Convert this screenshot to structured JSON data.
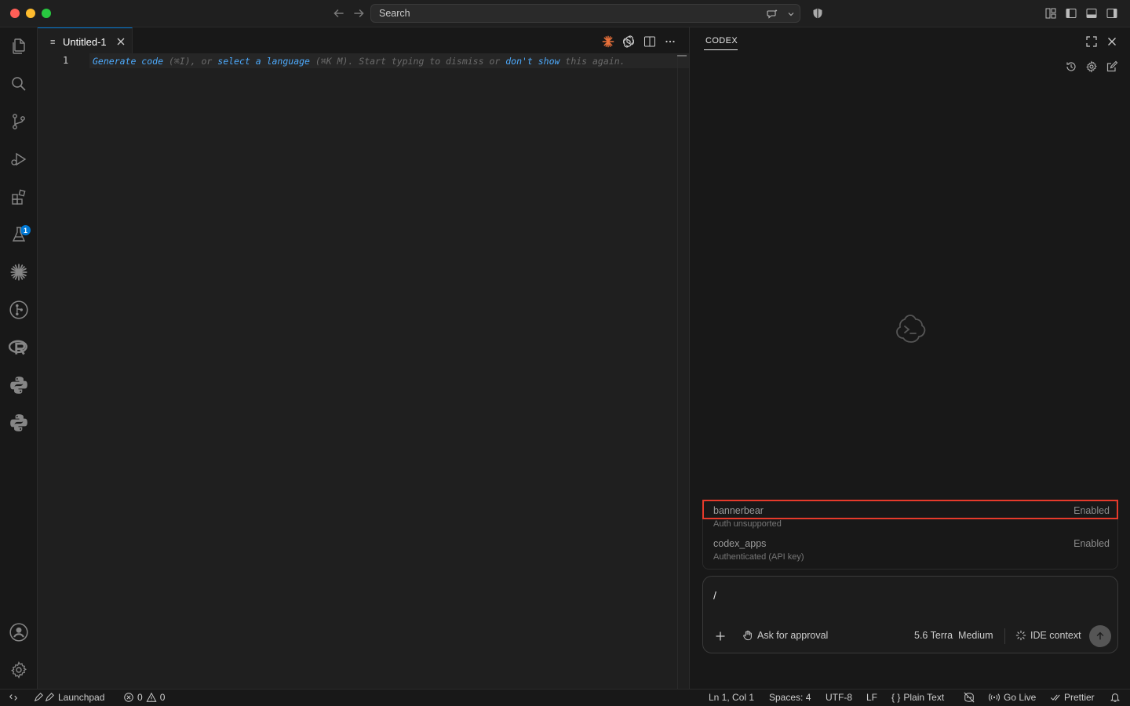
{
  "titlebar": {
    "search_placeholder": "Search"
  },
  "activity_bar": {
    "extensions_badge": "1"
  },
  "editor": {
    "tab_label": "Untitled-1",
    "line_number": "1",
    "hint": {
      "generate": "Generate code",
      "shortcut1": " (⌘I), or ",
      "select_language": "select a language",
      "shortcut2": " (⌘K M). Start typing to dismiss or ",
      "dont_show": "don't show",
      "tail": " this again."
    }
  },
  "codex": {
    "title": "CODEX",
    "mcp_servers": [
      {
        "name": "bannerbear",
        "status": "Enabled",
        "auth": "Auth unsupported"
      },
      {
        "name": "codex_apps",
        "status": "Enabled",
        "auth": "Authenticated (API key)"
      }
    ],
    "composer": {
      "input_value": "/",
      "approval_label": "Ask for approval",
      "model_label": "5.6 Terra  Medium",
      "ide_context_label": "IDE context"
    }
  },
  "statusbar": {
    "launchpad": "Launchpad",
    "errors": "0",
    "warnings": "0",
    "cursor": "Ln 1, Col 1",
    "spaces": "Spaces: 4",
    "encoding": "UTF-8",
    "eol": "LF",
    "language": "Plain Text",
    "go_live": "Go Live",
    "prettier": "Prettier"
  },
  "colors": {
    "accent": "#0078d4",
    "highlight_box": "#e53a2b",
    "link": "#4daafc",
    "claude_orange": "#e8703a"
  }
}
